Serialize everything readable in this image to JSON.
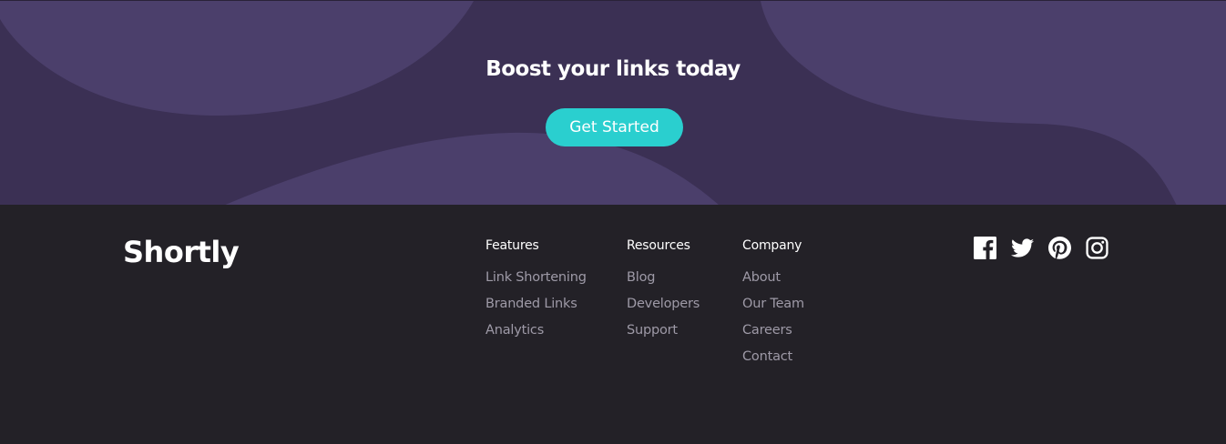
{
  "boost": {
    "title": "Boost your links today",
    "cta_label": "Get Started"
  },
  "footer": {
    "logo": "Shortly",
    "columns": [
      {
        "heading": "Features",
        "links": [
          "Link Shortening",
          "Branded Links",
          "Analytics"
        ]
      },
      {
        "heading": "Resources",
        "links": [
          "Blog",
          "Developers",
          "Support"
        ]
      },
      {
        "heading": "Company",
        "links": [
          "About",
          "Our Team",
          "Careers",
          "Contact"
        ]
      }
    ],
    "social": [
      "facebook-icon",
      "twitter-icon",
      "pinterest-icon",
      "instagram-icon"
    ]
  },
  "colors": {
    "boost_bg": "#3b3054",
    "boost_shape": "#4b3f6b",
    "cta": "#2acfcf",
    "footer_bg": "#232127",
    "link": "#9e9aa7"
  }
}
